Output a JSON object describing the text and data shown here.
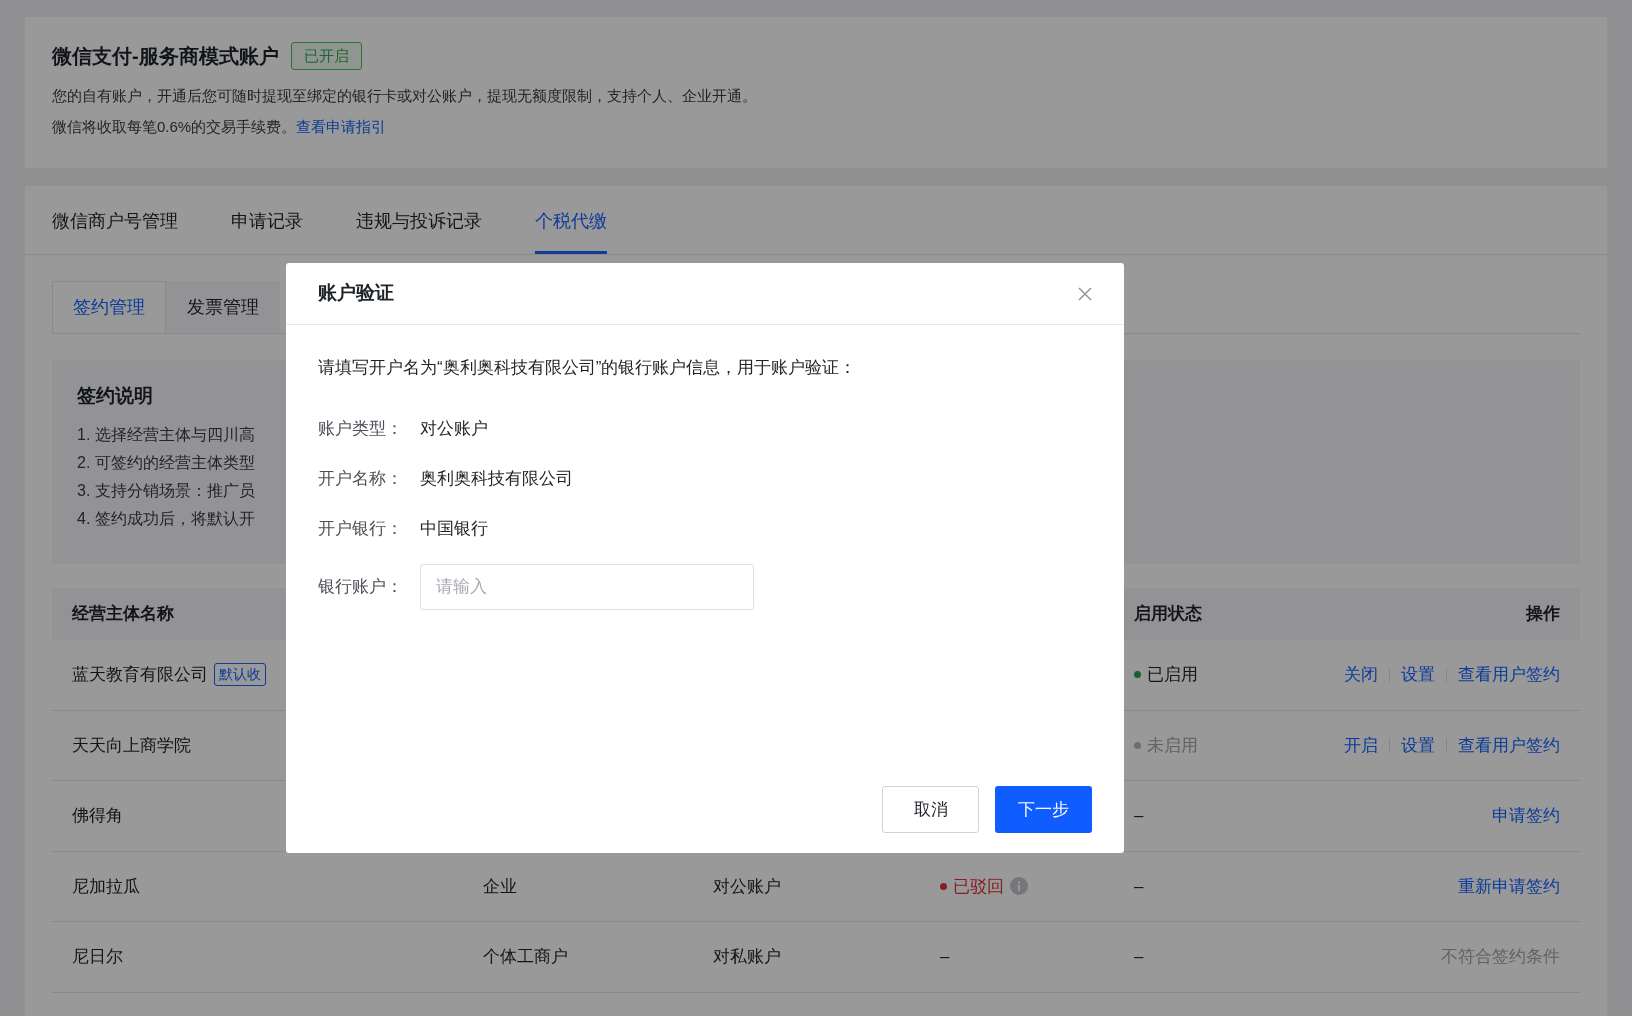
{
  "account": {
    "title": "微信支付-服务商模式账户",
    "badge": "已开启",
    "description": "您的自有账户，开通后您可随时提现至绑定的银行卡或对公账户，提现无额度限制，支持个人、企业开通。",
    "fee_note": "微信将收取每笔0.6%的交易手续费。",
    "guide_link": "查看申请指引"
  },
  "tabs": [
    {
      "label": "微信商户号管理",
      "selected": false
    },
    {
      "label": "申请记录",
      "selected": false
    },
    {
      "label": "违规与投诉记录",
      "selected": false
    },
    {
      "label": "个税代缴",
      "selected": true
    }
  ],
  "subtabs": [
    {
      "label": "签约管理",
      "selected": true
    },
    {
      "label": "发票管理",
      "selected": false
    }
  ],
  "instructions": {
    "title": "签约说明",
    "items": [
      "1. 选择经营主体与四川高",
      "2. 可签约的经营主体类型",
      "3. 支持分销场景：推广员",
      "4. 签约成功后，将默认开"
    ]
  },
  "table": {
    "columns": {
      "entity_name": "经营主体名称",
      "enable_status": "启用状态",
      "actions": "操作"
    },
    "rows": [
      {
        "name": "蓝天教育有限公司",
        "tag": "默认收",
        "enable_status": {
          "text": "已启用",
          "kind": "on"
        },
        "actions": [
          {
            "label": "关闭",
            "kind": "link"
          },
          {
            "label": "设置",
            "kind": "link"
          },
          {
            "label": "查看用户签约",
            "kind": "link"
          }
        ]
      },
      {
        "name": "天天向上商学院",
        "enable_status": {
          "text": "未启用",
          "kind": "off"
        },
        "actions": [
          {
            "label": "开启",
            "kind": "link"
          },
          {
            "label": "设置",
            "kind": "link"
          },
          {
            "label": "查看用户签约",
            "kind": "link"
          }
        ]
      },
      {
        "name": "佛得角",
        "enable_status": {
          "text": "–",
          "kind": "none"
        },
        "actions": [
          {
            "label": "申请签约",
            "kind": "link"
          }
        ]
      },
      {
        "name": "尼加拉瓜",
        "column_2": "企业",
        "column_3": "对公账户",
        "column_4": {
          "text": "已驳回",
          "kind": "rejected",
          "info": true
        },
        "enable_status": {
          "text": "–",
          "kind": "none"
        },
        "actions": [
          {
            "label": "重新申请签约",
            "kind": "link"
          }
        ]
      },
      {
        "name": "尼日尔",
        "column_2": "个体工商户",
        "column_3": "对私账户",
        "column_4": {
          "text": "–",
          "kind": "none",
          "info": false
        },
        "enable_status": {
          "text": "–",
          "kind": "none"
        },
        "actions": [
          {
            "label": "不符合签约条件",
            "kind": "disabled"
          }
        ]
      }
    ]
  },
  "modal": {
    "title": "账户验证",
    "intro": "请填写开户名为“奥利奥科技有限公司”的银行账户信息，用于账户验证：",
    "fields": [
      {
        "label": "账户类型：",
        "value": "对公账户"
      },
      {
        "label": "开户名称：",
        "value": "奥利奥科技有限公司"
      },
      {
        "label": "开户银行：",
        "value": "中国银行"
      }
    ],
    "input": {
      "label": "银行账户：",
      "placeholder": "请输入"
    },
    "buttons": [
      {
        "label": "取消",
        "kind": "secondary"
      },
      {
        "label": "下一步",
        "kind": "primary"
      }
    ]
  }
}
